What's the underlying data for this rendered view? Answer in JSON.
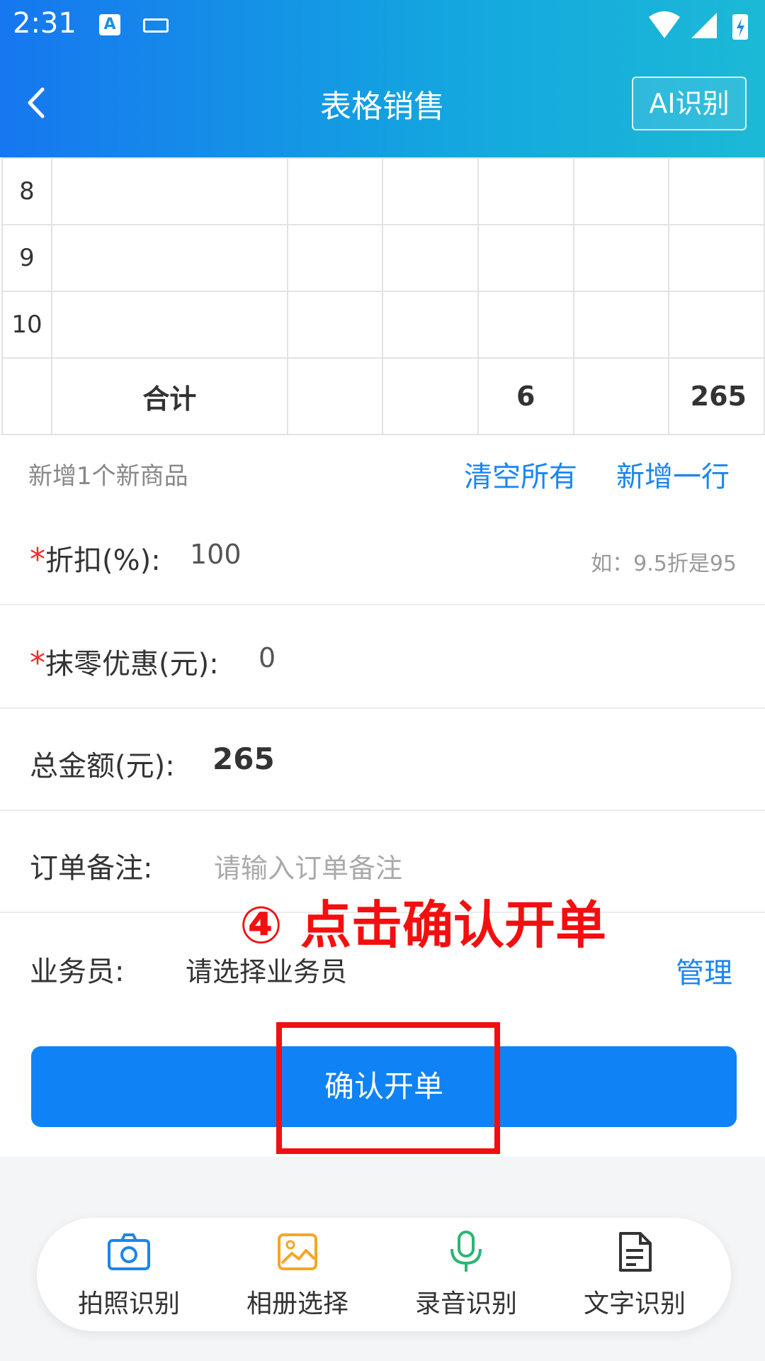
{
  "status": {
    "time": "2:31"
  },
  "header": {
    "title": "表格销售",
    "ai_button": "AI识别"
  },
  "table": {
    "rows": [
      {
        "index": "8"
      },
      {
        "index": "9"
      },
      {
        "index": "10"
      }
    ],
    "total": {
      "label": "合计",
      "quantity": "6",
      "amount": "265"
    }
  },
  "row_actions": {
    "new_count": "新增1个新商品",
    "clear_all": "清空所有",
    "add_row": "新增一行"
  },
  "discount": {
    "required": "*",
    "label": "折扣(%):",
    "value": "100",
    "hint": "如：9.5折是95"
  },
  "rounding": {
    "required": "*",
    "label": "抹零优惠(元):",
    "value": "0"
  },
  "total_amount": {
    "label": "总金额(元):",
    "value": "265"
  },
  "remark": {
    "label": "订单备注:",
    "placeholder": "请输入订单备注"
  },
  "salesperson": {
    "label": "业务员:",
    "value": "请选择业务员",
    "manage": "管理"
  },
  "confirm_button": "确认开单",
  "annotation": "④ 点击确认开单",
  "toolbar": {
    "items": [
      {
        "label": "拍照识别",
        "icon": "camera-icon",
        "color": "#1a86f0"
      },
      {
        "label": "相册选择",
        "icon": "gallery-icon",
        "color": "#f5a623"
      },
      {
        "label": "录音识别",
        "icon": "microphone-icon",
        "color": "#2bb673"
      },
      {
        "label": "文字识别",
        "icon": "document-icon",
        "color": "#333333"
      }
    ]
  }
}
